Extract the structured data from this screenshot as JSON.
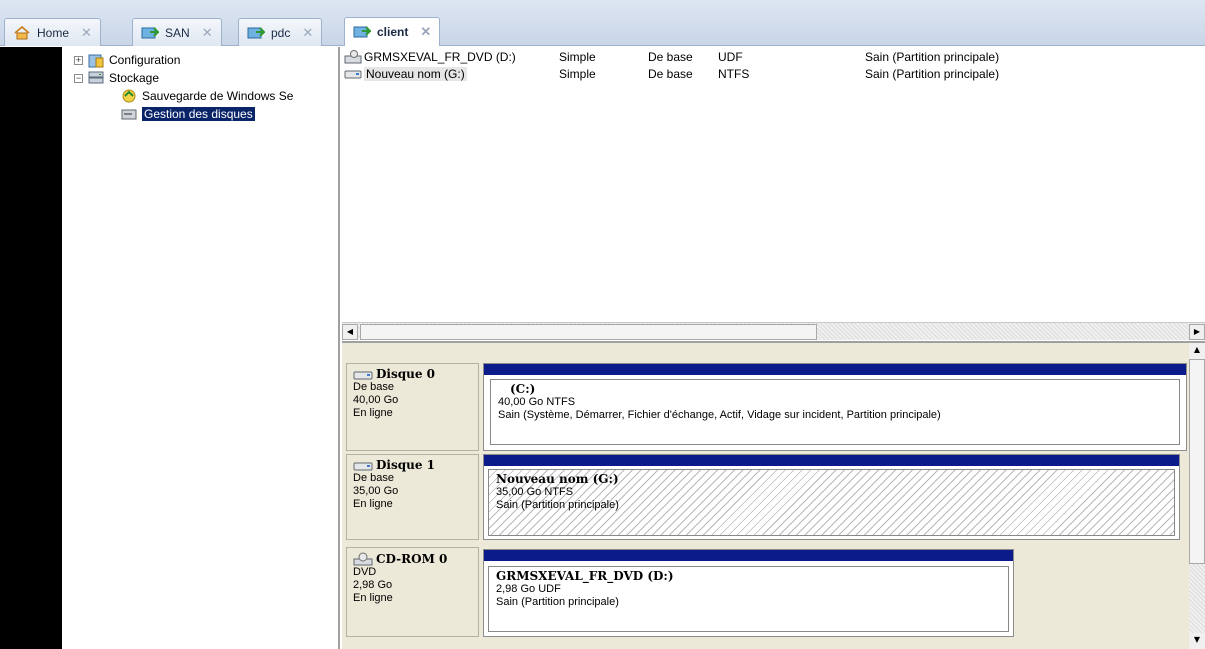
{
  "tabs": [
    {
      "label": "Home",
      "icon": "home-icon",
      "active": false
    },
    {
      "label": "SAN",
      "icon": "vm-icon",
      "active": false
    },
    {
      "label": "pdc",
      "icon": "vm-icon",
      "active": false
    },
    {
      "label": "client",
      "icon": "vm-icon",
      "active": true
    }
  ],
  "tree": {
    "configuration": "Configuration",
    "storage": "Stockage",
    "backup": "Sauvegarde de Windows Se",
    "disk_mgmt": "Gestion des disques"
  },
  "volumes": [
    {
      "name": "GRMSXEVAL_FR_DVD (D:)",
      "layout": "Simple",
      "type": "De base",
      "fs": "UDF",
      "status": "Sain (Partition principale)"
    },
    {
      "name": "Nouveau nom (G:)",
      "layout": "Simple",
      "type": "De base",
      "fs": "NTFS",
      "status": "Sain (Partition principale)"
    }
  ],
  "disks": [
    {
      "name": "Disque 0",
      "kind": "De base",
      "size": "40,00 Go",
      "state": "En ligne",
      "partition": {
        "name": "(C:)",
        "detail": "40,00 Go NTFS",
        "status": "Sain (Système, Démarrer, Fichier d'échange, Actif, Vidage sur incident, Partition principale)"
      }
    },
    {
      "name": "Disque 1",
      "kind": "De base",
      "size": "35,00 Go",
      "state": "En ligne",
      "partition": {
        "name": "Nouveau nom  (G:)",
        "detail": "35,00 Go NTFS",
        "status": "Sain (Partition principale)"
      }
    },
    {
      "name": "CD-ROM 0",
      "kind": "DVD",
      "size": "2,98 Go",
      "state": "En ligne",
      "partition": {
        "name": "GRMSXEVAL_FR_DVD  (D:)",
        "detail": "2,98 Go UDF",
        "status": "Sain (Partition principale)"
      }
    }
  ],
  "colors": {
    "disk_bar": "#0b1c8a",
    "selection": "#0a246a"
  }
}
